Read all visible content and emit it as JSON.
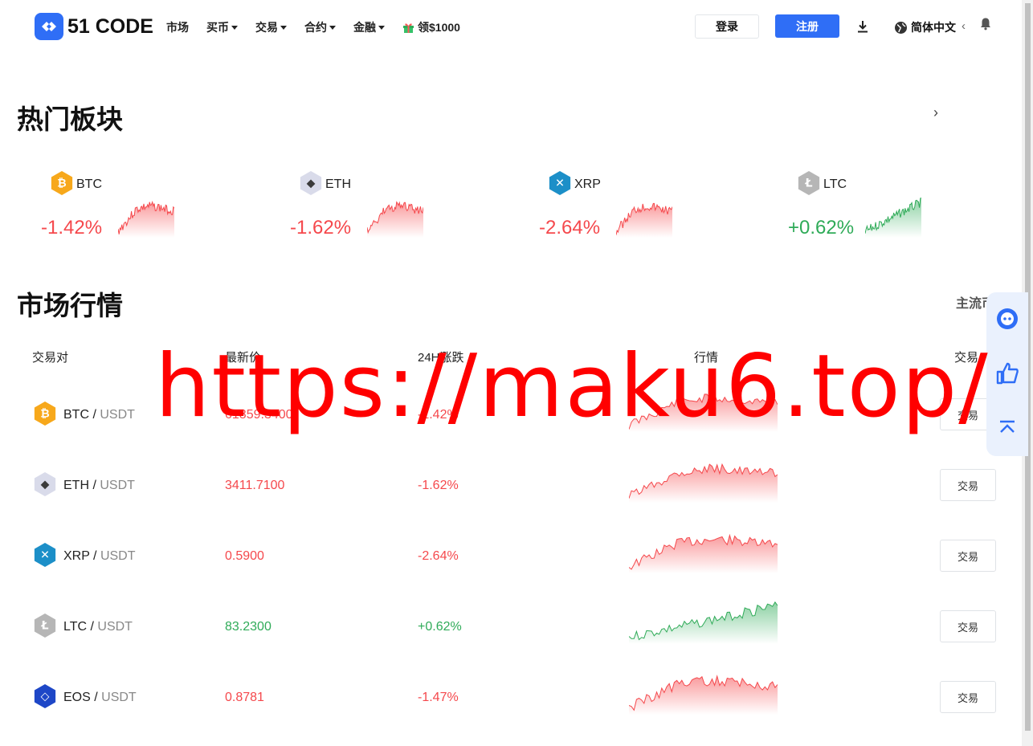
{
  "header": {
    "brand": "51 CODE",
    "nav": [
      {
        "label": "市场",
        "caret": false
      },
      {
        "label": "买币",
        "caret": true
      },
      {
        "label": "交易",
        "caret": true
      },
      {
        "label": "合约",
        "caret": true
      },
      {
        "label": "金融",
        "caret": true
      },
      {
        "label": "领$1000",
        "icon": "gift-icon"
      }
    ],
    "login_label": "登录",
    "register_label": "注册",
    "language": "简体中文",
    "accent_color": "#2f6ef6"
  },
  "hot": {
    "title": "热门板块",
    "cards": [
      {
        "symbol": "BTC",
        "change": "-1.42%",
        "trend": "down",
        "icon": "btc-icon"
      },
      {
        "symbol": "ETH",
        "change": "-1.62%",
        "trend": "down",
        "icon": "eth-icon"
      },
      {
        "symbol": "XRP",
        "change": "-2.64%",
        "trend": "down",
        "icon": "xrp-icon"
      },
      {
        "symbol": "LTC",
        "change": "+0.62%",
        "trend": "up",
        "icon": "ltc-icon"
      }
    ]
  },
  "market": {
    "title": "市场行情",
    "filter_label": "主流币",
    "columns": [
      "交易对",
      "最新价",
      "24H涨跌",
      "行情",
      "交易"
    ],
    "rows": [
      {
        "base": "BTC",
        "quote": "USDT",
        "sep": " / ",
        "price": "61859.3400",
        "change": "-1.42%",
        "trend": "down",
        "trade_label": "交易",
        "icon": "btc-icon"
      },
      {
        "base": "ETH",
        "quote": "USDT",
        "sep": " / ",
        "price": "3411.7100",
        "change": "-1.62%",
        "trend": "down",
        "trade_label": "交易",
        "icon": "eth-icon"
      },
      {
        "base": "XRP",
        "quote": "USDT",
        "sep": " / ",
        "price": "0.5900",
        "change": "-2.64%",
        "trend": "down",
        "trade_label": "交易",
        "icon": "xrp-icon"
      },
      {
        "base": "LTC",
        "quote": "USDT",
        "sep": " / ",
        "price": "83.2300",
        "change": "+0.62%",
        "trend": "up",
        "trade_label": "交易",
        "icon": "ltc-icon"
      },
      {
        "base": "EOS",
        "quote": "USDT",
        "sep": " / ",
        "price": "0.8781",
        "change": "-1.47%",
        "trend": "down",
        "trade_label": "交易",
        "icon": "eos-icon"
      }
    ]
  },
  "watermark": "https://maku6.top/",
  "colors": {
    "down": "#f5484c",
    "up": "#2fab58"
  },
  "side_float": [
    "chat-icon",
    "thumbs-up-icon",
    "back-to-top-icon"
  ]
}
